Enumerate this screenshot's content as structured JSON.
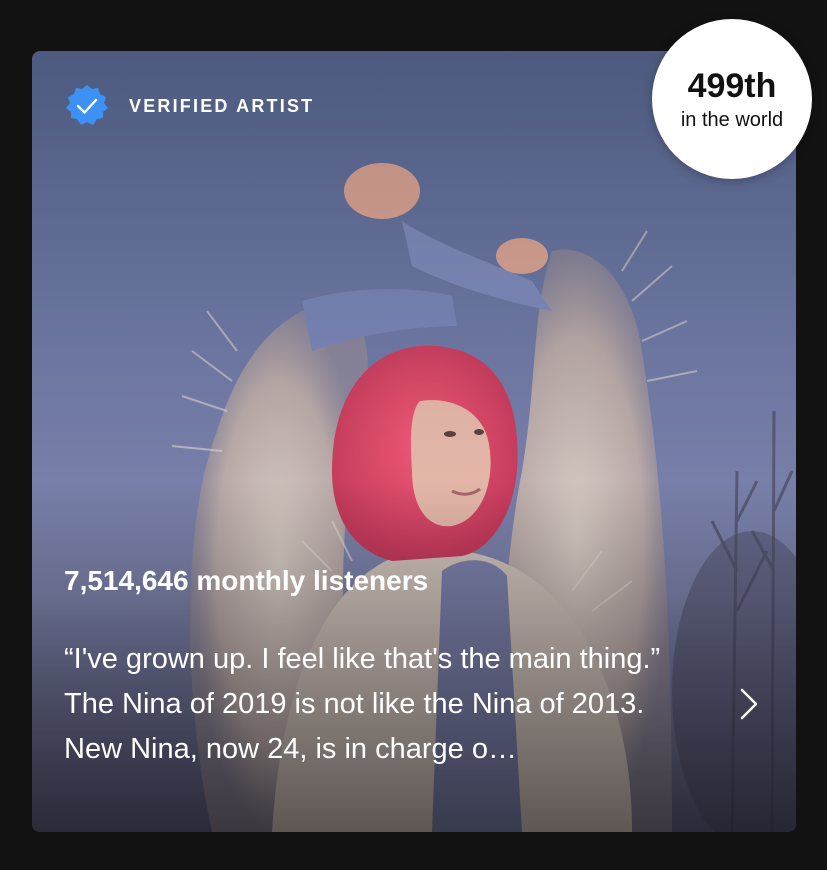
{
  "artist_card": {
    "verified_label": "VERIFIED ARTIST",
    "monthly_listeners": "7,514,646 monthly listeners",
    "bio": "“I've grown up. I feel like that's the main thing.” The Nina of 2019 is not like the Nina of 2013.  New Nina, now 24, is in charge o…"
  },
  "rank_badge": {
    "rank": "499th",
    "caption": "in the world"
  },
  "icons": {
    "verified": "verified-check-icon",
    "more": "chevron-right-icon"
  },
  "colors": {
    "background": "#121212",
    "badge_blue": "#3d91f4",
    "text": "#ffffff",
    "rank_bg": "#ffffff"
  }
}
